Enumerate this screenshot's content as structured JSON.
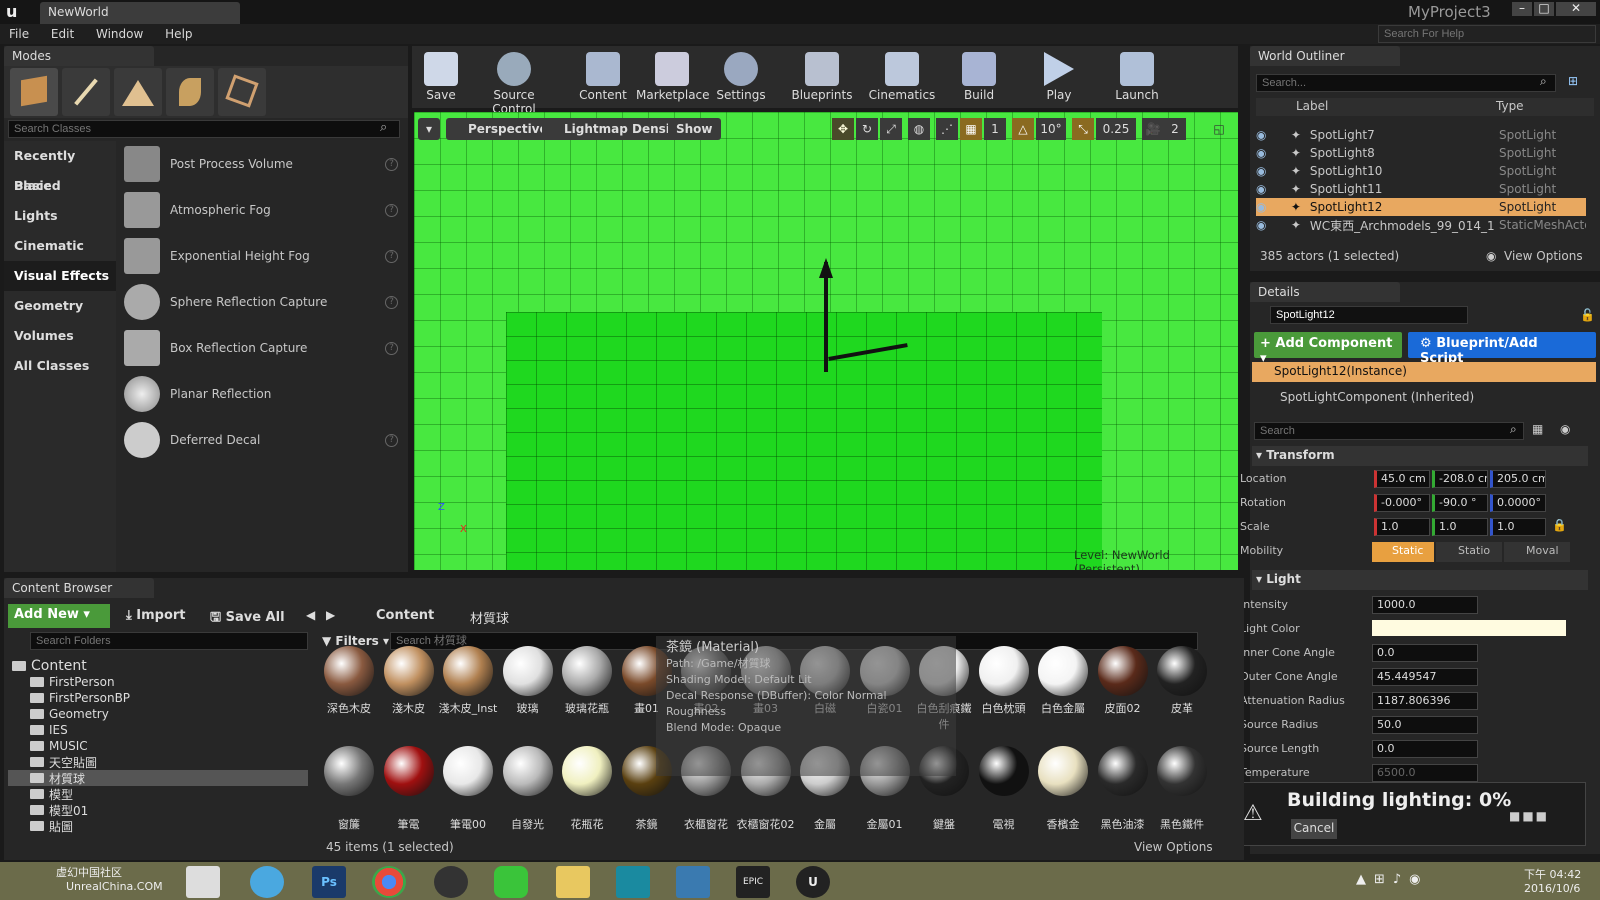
{
  "title_bar": {
    "tab": "NewWorld",
    "project": "MyProject3"
  },
  "menu": [
    "File",
    "Edit",
    "Window",
    "Help"
  ],
  "search_help_placeholder": "Search For Help",
  "modes": {
    "tab": "Modes",
    "search_placeholder": "Search Classes",
    "categories": [
      "Recently Placed",
      "Basic",
      "Lights",
      "Cinematic",
      "Visual Effects",
      "Geometry",
      "Volumes",
      "All Classes"
    ],
    "selected_category": "Visual Effects",
    "items": [
      "Post Process Volume",
      "Atmospheric Fog",
      "Exponential Height Fog",
      "Sphere Reflection Capture",
      "Box Reflection Capture",
      "Planar Reflection",
      "Deferred Decal"
    ]
  },
  "toolbar": [
    "Save",
    "Source Control",
    "Content",
    "Marketplace",
    "Settings",
    "Blueprints",
    "Cinematics",
    "Build",
    "Play",
    "Launch"
  ],
  "viewport": {
    "perspective": "Perspective",
    "view_mode": "Lightmap Density",
    "show": "Show",
    "grid_snap": "1",
    "angle_snap": "10°",
    "scale_snap": "0.25",
    "camera_speed": "2",
    "level": "Level:  NewWorld (Persistent)",
    "axis_z": "Z",
    "axis_x": "X"
  },
  "outliner": {
    "tab": "World Outliner",
    "search_placeholder": "Search...",
    "col_label": "Label",
    "col_type": "Type",
    "rows": [
      {
        "label": "SpotLight7",
        "type": "SpotLight"
      },
      {
        "label": "SpotLight8",
        "type": "SpotLight"
      },
      {
        "label": "SpotLight10",
        "type": "SpotLight"
      },
      {
        "label": "SpotLight11",
        "type": "SpotLight"
      },
      {
        "label": "SpotLight12",
        "type": "SpotLight"
      },
      {
        "label": "WC東西_Archmodels_99_014_1",
        "type": "StaticMeshActor"
      }
    ],
    "status": "385 actors (1 selected)",
    "view_options": "View Options"
  },
  "details": {
    "tab": "Details",
    "name": "SpotLight12",
    "add_component": "Add Component",
    "blueprint": "Blueprint/Add Script",
    "instance": "SpotLight12(Instance)",
    "component": "SpotLightComponent (Inherited)",
    "search_placeholder": "Search",
    "transform": "Transform",
    "location_label": "Location",
    "rotation_label": "Rotation",
    "scale_label": "Scale",
    "mobility_label": "Mobility",
    "location": [
      "45.0 cm",
      "-208.0 cm",
      "205.0 cm"
    ],
    "rotation": [
      "-0.000°",
      "-90.0 °",
      "0.0000°"
    ],
    "scale": [
      "1.0",
      "1.0",
      "1.0"
    ],
    "mobility": [
      "Static",
      "Statio",
      "Moval"
    ],
    "light": "Light",
    "intensity_label": "Intensity",
    "intensity": "1000.0",
    "light_color_label": "Light Color",
    "inner_label": "Inner Cone Angle",
    "inner": "0.0",
    "outer_label": "Outer Cone Angle",
    "outer": "45.449547",
    "atten_label": "Attenuation Radius",
    "atten": "1187.806396",
    "src_radius_label": "Source Radius",
    "src_radius": "50.0",
    "src_length_label": "Source Length",
    "src_length": "0.0",
    "temp_label": "Temperature",
    "temp": "6500.0"
  },
  "build": {
    "text": "Building lighting:  0%",
    "cancel": "Cancel"
  },
  "content_browser": {
    "tab": "Content Browser",
    "add_new": "Add New",
    "import": "Import",
    "save_all": "Save All",
    "path_root": "Content",
    "path_sub": "材質球",
    "search_folders": "Search Folders",
    "filters": "Filters",
    "search_assets": "Search 材質球",
    "folders": [
      "Content",
      "FirstPerson",
      "FirstPersonBP",
      "Geometry",
      "IES",
      "MUSIC",
      "天空貼圖",
      "材質球",
      "模型",
      "模型01",
      "貼圖"
    ],
    "row1": [
      "深色木皮",
      "淺木皮",
      "淺木皮_Inst",
      "玻璃",
      "玻璃花瓶",
      "畫01",
      "畫02",
      "畫03",
      "白磁",
      "白瓷01",
      "白色刮痕鐵件",
      "白色枕頭",
      "白色金屬",
      "皮面02",
      "皮革"
    ],
    "row2": [
      "窗簾",
      "筆電",
      "筆電00",
      "自發光",
      "花瓶花",
      "茶鏡",
      "衣櫃窗花",
      "衣櫃窗花02",
      "金屬",
      "金屬01",
      "鍵盤",
      "電視",
      "香檳金",
      "黑色油漆",
      "黑色鐵件"
    ],
    "status": "45 items (1 selected)",
    "view_options": "View Options",
    "tooltip": {
      "title": "茶鏡 (Material)",
      "path": "Path: /Game/材質球",
      "shading": "Shading Model: Default Lit",
      "decal": "Decal Response (DBuffer): Color Normal Roughness",
      "blend": "Blend Mode: Opaque"
    }
  },
  "taskbar": {
    "time": "下午 04:42",
    "date": "2016/10/6",
    "watermark": "UnrealChina.COM",
    "watermark_cn": "虚幻中国社区"
  }
}
